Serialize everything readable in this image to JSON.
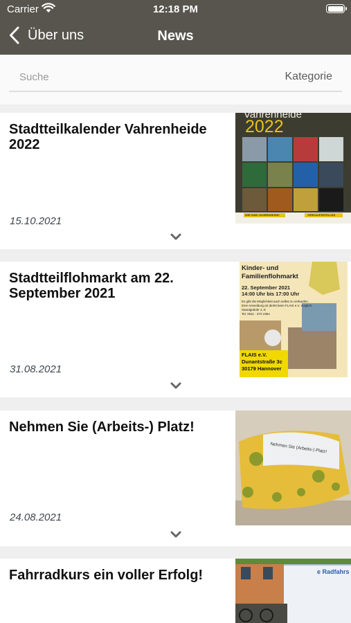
{
  "status_bar": {
    "carrier": "Carrier",
    "time": "12:18 PM"
  },
  "nav": {
    "back_label": "Über uns",
    "title": "News"
  },
  "search": {
    "placeholder": "Suche",
    "category_label": "Kategorie"
  },
  "news": [
    {
      "title": "Stadtteilkalender Vahrenheide 2022",
      "date": "15.10.2021",
      "thumb": {
        "heading_partial": "Vahrenheide",
        "year": "2022",
        "footer_left": "WIR SIND VAHRENHEIDE!",
        "footer_right": "VERKAUFSSTELLEN"
      }
    },
    {
      "title": "Stadtteilflohmarkt am 22. September 2021",
      "date": "31.08.2021",
      "thumb": {
        "line1": "Kinder- und",
        "line2": "Familienflohmarkt",
        "when1": "22. September 2021",
        "when2": "14:00 Uhr bis 17:00 Uhr",
        "note1": "Es gibt die Möglichkeit auch selbst zu verkaufen.",
        "note2": "Eine Anmeldung ist direkt beim FLAIS e.V. möglich.",
        "note3": "Standgebühr 2,-€",
        "note4": "Tel. 0511 - 373 1954",
        "org": "FLAIS e.V.",
        "street": "Dunantstraße 3c",
        "city": "30179 Hannover"
      }
    },
    {
      "title": "Nehmen Sie (Arbeits-) Platz!",
      "date": "24.08.2021",
      "thumb": {
        "sign": "Nehmen Sie (Arbeits-) Platz!"
      }
    },
    {
      "title": "Fahrradkurs ein voller Erfolg!",
      "date": "",
      "thumb": {
        "truck_text": "e Radfahrs"
      }
    }
  ],
  "colors": {
    "nav_bg": "#57554d",
    "title_text": "#111111",
    "date_text": "#3e4650",
    "page_bg": "#efefef"
  },
  "icons": {
    "back": "chevron-left-icon",
    "expand": "chevron-down-icon",
    "wifi": "wifi-icon",
    "battery": "battery-icon"
  }
}
